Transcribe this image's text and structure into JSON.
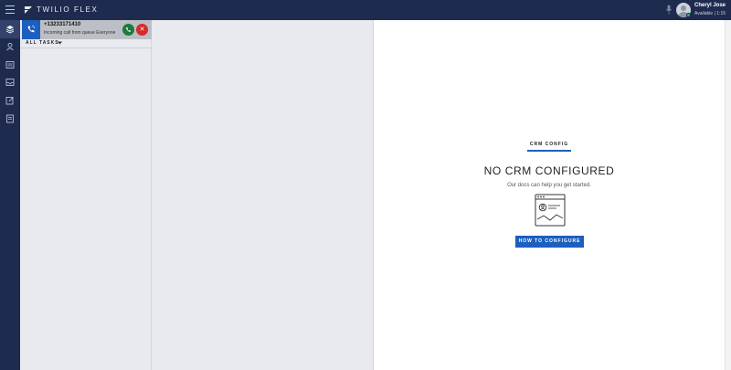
{
  "header": {
    "logo_text": "TWILIO FLEX",
    "user_name": "Cheryl Jose",
    "user_status": "Available | 1:15"
  },
  "nav": {
    "items": [
      {
        "icon": "layers-icon",
        "active": true
      },
      {
        "icon": "user-icon",
        "active": false
      },
      {
        "icon": "list-icon",
        "active": false
      },
      {
        "icon": "inbox-icon",
        "active": false
      },
      {
        "icon": "notes-icon",
        "active": false
      },
      {
        "icon": "report-icon",
        "active": false
      }
    ]
  },
  "tasklist": {
    "task": {
      "number": "+13233171410",
      "subtitle": "Incoming call from queue Everyone",
      "channel_icon": "phone-icon"
    },
    "filter_label": "ALL TASKS"
  },
  "crm": {
    "tab_label": "CRM CONFIG",
    "title": "NO CRM CONFIGURED",
    "subtitle": "Our docs can help you get started.",
    "button_label": "HOW TO CONFIGURE"
  },
  "colors": {
    "topbar": "#1e2b4e",
    "accent": "#1c5fc0",
    "accept": "#1b7a3e",
    "reject": "#d52b2b"
  }
}
